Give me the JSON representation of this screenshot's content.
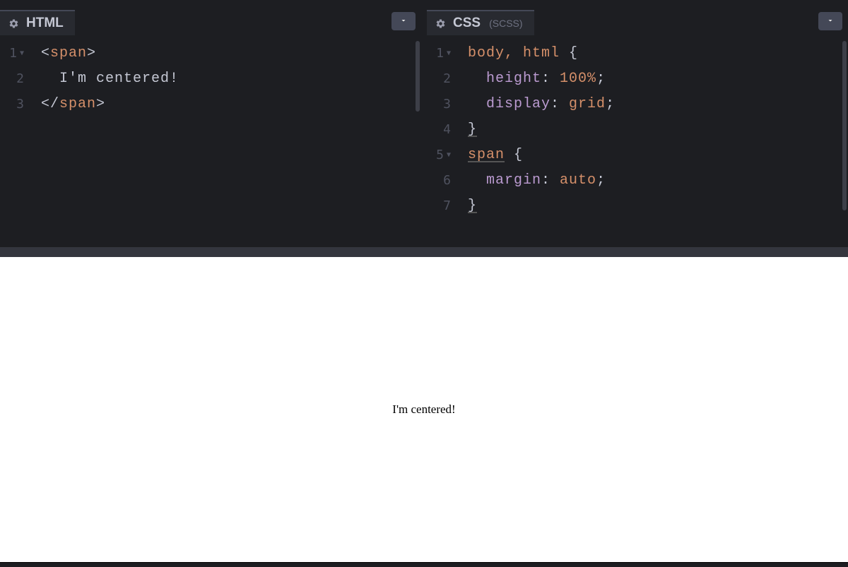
{
  "panels": {
    "html": {
      "title": "HTML",
      "subtitle": "",
      "code": {
        "line1": {
          "open": "<",
          "tag": "span",
          "close": ">"
        },
        "line2": {
          "text": "I'm centered!"
        },
        "line3": {
          "open": "</",
          "tag": "span",
          "close": ">"
        }
      },
      "gutter": [
        "1",
        "2",
        "3"
      ]
    },
    "css": {
      "title": "CSS",
      "subtitle": "(SCSS)",
      "code": {
        "line1": {
          "sel": "body, html",
          "brace": " {"
        },
        "line2": {
          "prop": "height",
          "colon": ": ",
          "val": "100%",
          "semi": ";"
        },
        "line3": {
          "prop": "display",
          "colon": ": ",
          "val": "grid",
          "semi": ";"
        },
        "line4": {
          "brace": "}"
        },
        "line5": {
          "sel": "span",
          "brace": " {"
        },
        "line6": {
          "prop": "margin",
          "colon": ": ",
          "val": "auto",
          "semi": ";"
        },
        "line7": {
          "brace": "}"
        }
      },
      "gutter": [
        "1",
        "2",
        "3",
        "4",
        "5",
        "6",
        "7"
      ]
    }
  },
  "output": {
    "text": "I'm centered!"
  }
}
